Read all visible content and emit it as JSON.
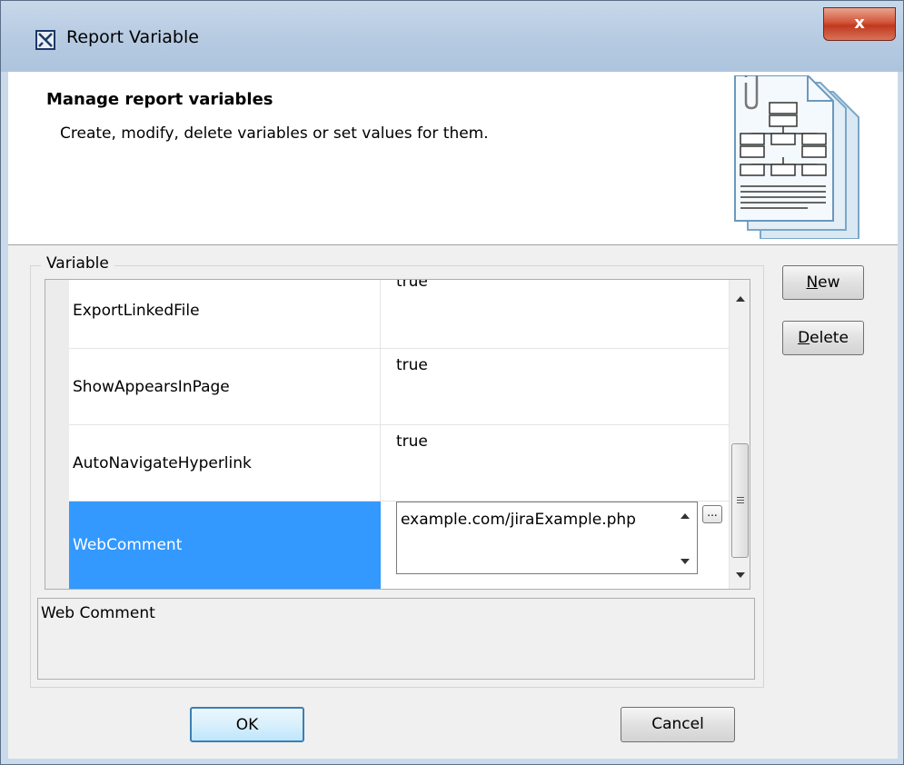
{
  "window": {
    "title": "Report Variable",
    "close_label": "x"
  },
  "header": {
    "title": "Manage report variables",
    "description": "Create, modify, delete variables or set values for them."
  },
  "variable_group": {
    "label": "Variable",
    "rows": [
      {
        "name": "ExportLinkedFile",
        "value": "true"
      },
      {
        "name": "ShowAppearsInPage",
        "value": "true"
      },
      {
        "name": "AutoNavigateHyperlink",
        "value": "true"
      },
      {
        "name": "WebComment",
        "value": "example.com/jiraExample.php",
        "selected": true
      }
    ],
    "ellipsis_label": "...",
    "description": "Web Comment"
  },
  "side_buttons": {
    "new_mnemonic": "N",
    "new_rest": "ew",
    "delete_mnemonic": "D",
    "delete_rest": "elete"
  },
  "footer": {
    "ok_label": "OK",
    "cancel_label": "Cancel"
  },
  "colors": {
    "selection": "#3399ff",
    "title_bar": "#b7cbe2",
    "close_button": "#c0391e"
  }
}
